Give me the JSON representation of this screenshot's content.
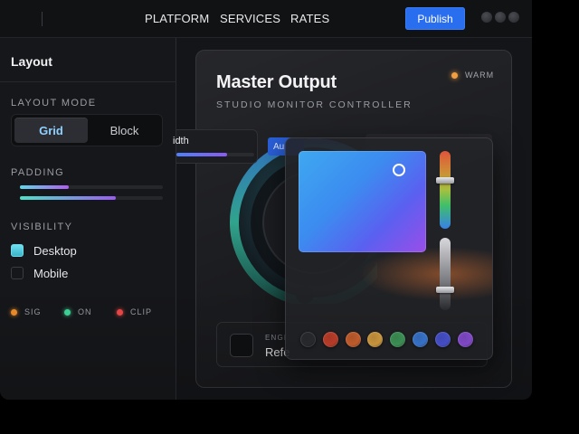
{
  "nav": {
    "links": [
      "PLATFORM",
      "SERVICES",
      "RATES"
    ],
    "publish_label": "Publish"
  },
  "sidebar": {
    "title": "Layout",
    "layout_mode": {
      "label": "LAYOUT MODE",
      "options": [
        "Grid",
        "Block"
      ],
      "selected": "Grid"
    },
    "padding": {
      "label": "PADDING",
      "sliders": [
        {
          "value": 0.34,
          "colors": [
            "#5ed9e8",
            "#b05cf0"
          ]
        },
        {
          "value": 0.67,
          "colors": [
            "#4fe0c8",
            "#9a5cf0"
          ]
        }
      ]
    },
    "visibility": {
      "label": "VISIBILITY",
      "items": [
        {
          "label": "Desktop",
          "checked": true
        },
        {
          "label": "Mobile",
          "checked": false
        }
      ]
    },
    "legend": [
      {
        "label": "SIG",
        "color": "#f0902a"
      },
      {
        "label": "ON",
        "color": "#3fd89a"
      },
      {
        "label": "CLIP",
        "color": "#f04848"
      }
    ]
  },
  "card": {
    "title": "Master Output",
    "subtitle": "STUDIO MONITOR CONTROLLER",
    "status": {
      "label": "WARM",
      "color": "#f0a040"
    },
    "bottom": {
      "label": "ENGI",
      "value": "Refe"
    }
  },
  "width_control": {
    "label": "idth",
    "value": 0.65,
    "auto_label": "Au"
  },
  "color_picker": {
    "hue_position": 0.38,
    "alpha_position": 0.72,
    "swatches": [
      "#2a2b2f",
      "#c8402a",
      "#d0622e",
      "#d8a040",
      "#3f9a5a",
      "#3a7ad8",
      "#4a54d8",
      "#8a4ed8"
    ]
  }
}
